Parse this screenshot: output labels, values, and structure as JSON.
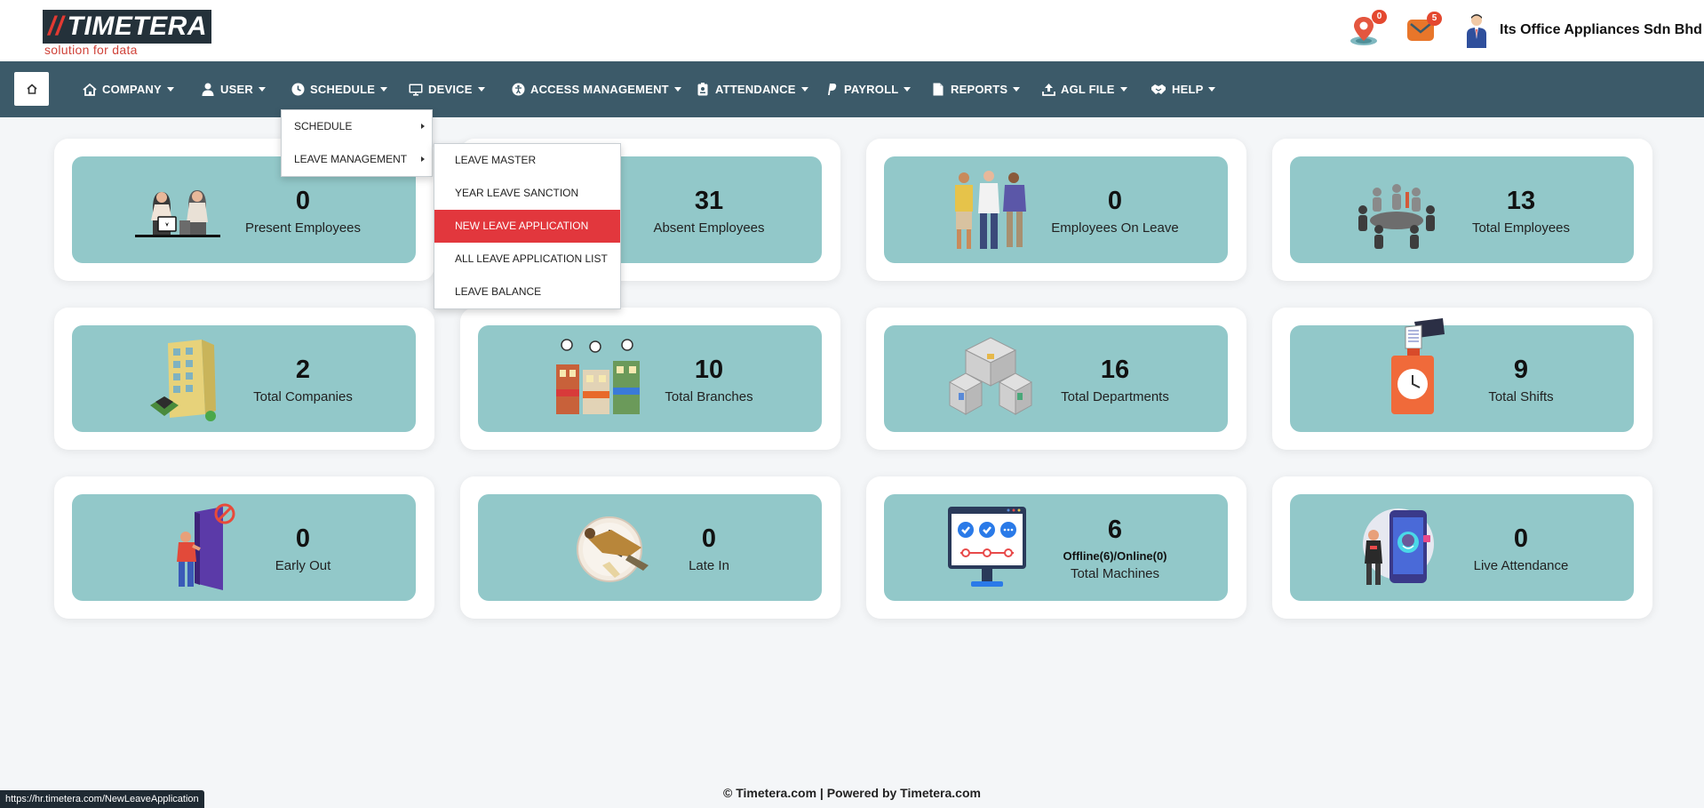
{
  "brand": {
    "name": "TIMETERA",
    "tagline": "solution for data"
  },
  "header": {
    "location_badge": "0",
    "mail_badge": "5",
    "company_name": "Its Office Appliances Sdn Bhd"
  },
  "nav": {
    "items": [
      {
        "label": "COMPANY"
      },
      {
        "label": "USER"
      },
      {
        "label": "SCHEDULE"
      },
      {
        "label": "DEVICE"
      },
      {
        "label": "ACCESS MANAGEMENT"
      },
      {
        "label": "ATTENDANCE"
      },
      {
        "label": "PAYROLL"
      },
      {
        "label": "REPORTS"
      },
      {
        "label": "AGL FILE"
      },
      {
        "label": "HELP"
      }
    ]
  },
  "schedule_menu": {
    "items": [
      {
        "label": "SCHEDULE"
      },
      {
        "label": "LEAVE MANAGEMENT"
      }
    ]
  },
  "leave_menu": {
    "items": [
      {
        "label": "LEAVE MASTER"
      },
      {
        "label": "YEAR LEAVE SANCTION"
      },
      {
        "label": "NEW LEAVE APPLICATION"
      },
      {
        "label": "ALL LEAVE APPLICATION LIST"
      },
      {
        "label": "LEAVE BALANCE"
      }
    ]
  },
  "cards": [
    {
      "value": "0",
      "label": "Present Employees"
    },
    {
      "value": "31",
      "label": "Absent Employees"
    },
    {
      "value": "0",
      "label": "Employees On Leave"
    },
    {
      "value": "13",
      "label": "Total Employees"
    },
    {
      "value": "2",
      "label": "Total Companies"
    },
    {
      "value": "10",
      "label": "Total Branches"
    },
    {
      "value": "16",
      "label": "Total Departments"
    },
    {
      "value": "9",
      "label": "Total Shifts"
    },
    {
      "value": "0",
      "label": "Early Out"
    },
    {
      "value": "0",
      "label": "Late In"
    },
    {
      "value": "6",
      "label": "Total Machines",
      "sub": "Offline(6)/Online(0)"
    },
    {
      "value": "0",
      "label": "Live Attendance"
    }
  ],
  "footer": {
    "text": "© Timetera.com | Powered by Timetera.com"
  },
  "status_url": "https://hr.timetera.com/NewLeaveApplication",
  "colors": {
    "nav_bg": "#3c5a69",
    "card_bg": "#92c8c9",
    "active_item": "#e2373d",
    "badge": "#e4482f"
  }
}
